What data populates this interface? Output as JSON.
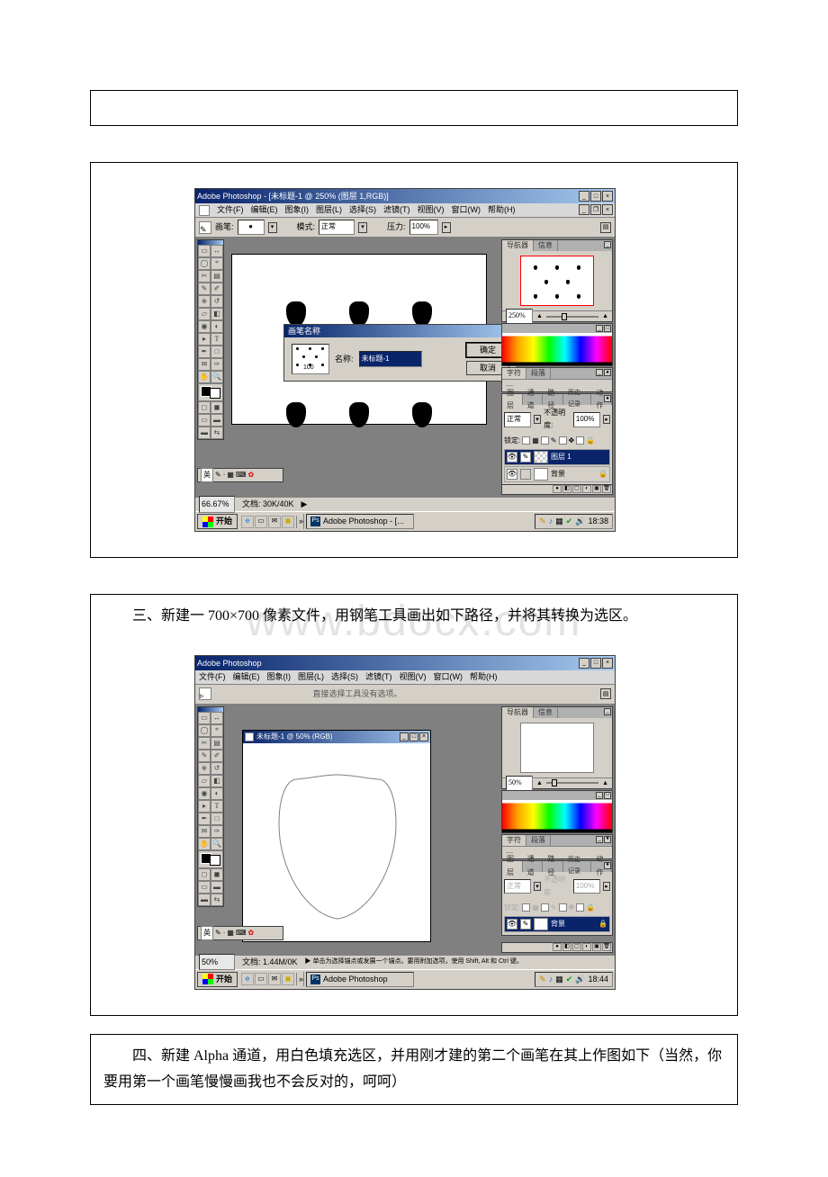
{
  "watermark": "www.bdocx.com",
  "section3": {
    "text": "三、新建一 700×700 像素文件，用钢笔工具画出如下路径，并将其转换为选区。"
  },
  "section4": {
    "text": "四、新建 Alpha 通道，用白色填充选区，并用刚才建的第二个画笔在其上作图如下（当然，你要用第一个画笔慢慢画我也不会反对的，呵呵）"
  },
  "ps_common": {
    "menus": [
      "文件(F)",
      "编辑(E)",
      "图象(I)",
      "图层(L)",
      "选择(S)",
      "滤镜(T)",
      "视图(V)",
      "窗口(W)",
      "帮助(H)"
    ],
    "start_label": "开始",
    "task_app": "Adobe Photoshop - [...",
    "tray_time1": "18:38",
    "tray_time2": "18:44",
    "nav_tab": "导航器",
    "info_tab": "信息",
    "char_tab1": "字符",
    "char_tab2": "段落",
    "layer_tabs": [
      "图层",
      "通道",
      "路径",
      "历史记录",
      "动作"
    ],
    "opacity_label": "不透明度:",
    "opacity_value": "100%",
    "lock_label": "锁定:",
    "layer_bg": "背景",
    "layer_1": "图层 1",
    "mode_label": "正常"
  },
  "fig1": {
    "title": "Adobe Photoshop - [未标题-1 @ 250% (图层 1,RGB)]",
    "opt_brush": "画笔:",
    "opt_mode": "模式:",
    "opt_mode_val": "正常",
    "opt_pressure": "压力:",
    "opt_pressure_val": "100%",
    "dialog_title": "画笔名称",
    "dialog_name_label": "名称:",
    "dialog_name_value": "未标题-1",
    "dialog_preview_size": "100",
    "btn_ok": "确定",
    "btn_cancel": "取消",
    "status_pct": "66.67%",
    "status_doc": "文档: 30K/40K",
    "ime": "英"
  },
  "fig2": {
    "title": "Adobe Photoshop",
    "doc_title": "未标题-1 @ 50% (RGB)",
    "opt_hint": "直接选择工具没有选项。",
    "status_pct": "50%",
    "status_doc": "文档: 1.44M/0K",
    "status_hint": "▶ 单击为选择锚点或发展一个锚点。要用附加选项，使用 Shift, Alt 和 Ctrl 键。",
    "ime": "英",
    "task_app": "Adobe Photoshop"
  }
}
